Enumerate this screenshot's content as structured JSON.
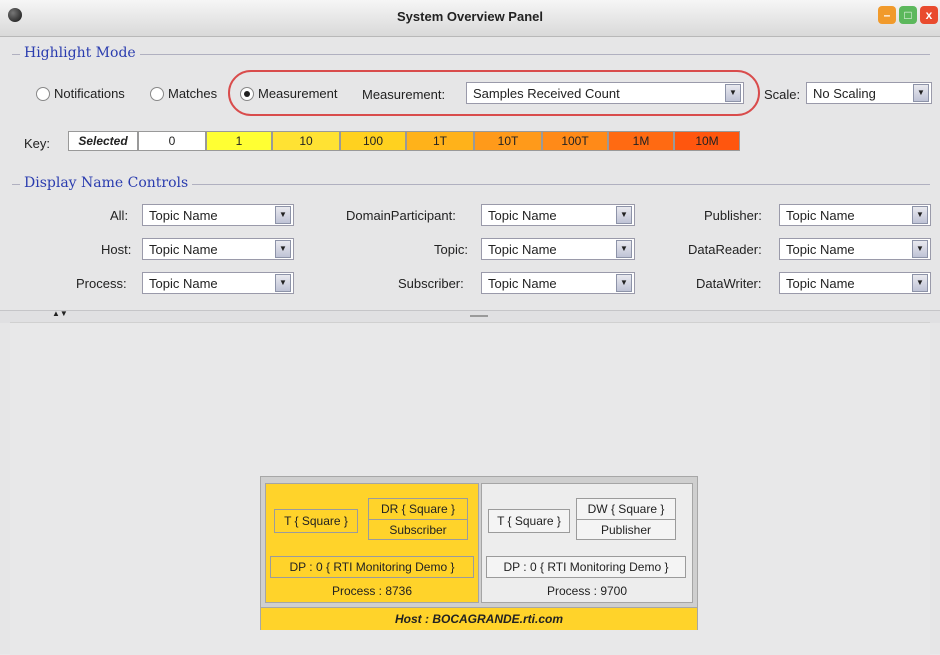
{
  "window": {
    "title": "System Overview Panel",
    "buttons": {
      "min": "–",
      "max": "□",
      "close": "x"
    }
  },
  "highlight_mode": {
    "title": "Highlight Mode",
    "radios": [
      {
        "label": "Notifications",
        "checked": false
      },
      {
        "label": "Matches",
        "checked": false
      },
      {
        "label": "Measurement",
        "checked": true
      }
    ],
    "measurement_label": "Measurement:",
    "measurement_value": "Samples Received Count",
    "scale_label": "Scale:",
    "scale_value": "No Scaling",
    "key_label": "Key:",
    "key_cells": [
      {
        "label": "Selected",
        "color": "#ffffff"
      },
      {
        "label": "0",
        "color": "#ffffff"
      },
      {
        "label": "1",
        "color": "#ffff33"
      },
      {
        "label": "10",
        "color": "#ffe233"
      },
      {
        "label": "100",
        "color": "#ffd11f"
      },
      {
        "label": "1T",
        "color": "#ffb21a"
      },
      {
        "label": "10T",
        "color": "#ff9a1a"
      },
      {
        "label": "100T",
        "color": "#ff8a18"
      },
      {
        "label": "1M",
        "color": "#ff6a12"
      },
      {
        "label": "10M",
        "color": "#ff560e"
      }
    ]
  },
  "display_name_controls": {
    "title": "Display Name Controls",
    "rows": [
      {
        "label": "All:",
        "value": "Topic Name"
      },
      {
        "label": "Host:",
        "value": "Topic Name"
      },
      {
        "label": "Process:",
        "value": "Topic Name"
      },
      {
        "label": "DomainParticipant:",
        "value": "Topic Name"
      },
      {
        "label": "Topic:",
        "value": "Topic Name"
      },
      {
        "label": "Subscriber:",
        "value": "Topic Name"
      },
      {
        "label": "Publisher:",
        "value": "Topic Name"
      },
      {
        "label": "DataReader:",
        "value": "Topic Name"
      },
      {
        "label": "DataWriter:",
        "value": "Topic Name"
      }
    ]
  },
  "diagram": {
    "host": "Host : BOCAGRANDE.rti.com",
    "processes": [
      {
        "topic": "T { Square }",
        "reader": "DR { Square }",
        "subscriber": "Subscriber",
        "participant": "DP : 0 { RTI Monitoring Demo }",
        "process": "Process : 8736"
      },
      {
        "topic": "T { Square }",
        "writer": "DW { Square }",
        "publisher": "Publisher",
        "participant": "DP : 0 { RTI Monitoring Demo }",
        "process": "Process : 9700"
      }
    ]
  }
}
